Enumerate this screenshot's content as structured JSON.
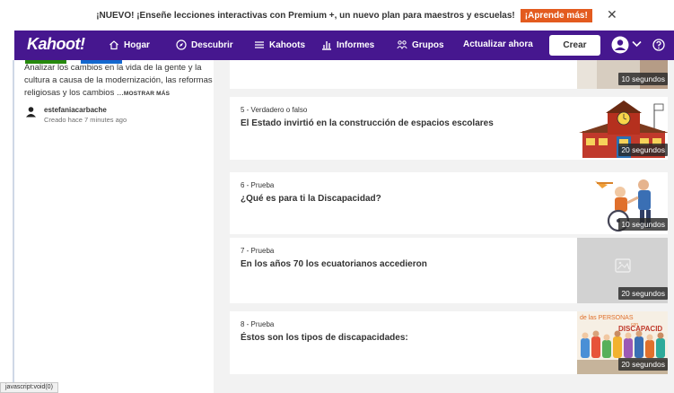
{
  "announcement": {
    "text": "¡NUEVO! ¡Enseñe lecciones interactivas con Premium +, un nuevo plan para maestros y escuelas!",
    "cta": "¡Aprende más!",
    "close_icon": "close-icon"
  },
  "nav": {
    "logo": "Kahoot!",
    "items": [
      {
        "label": "Hogar",
        "icon": "home-icon"
      },
      {
        "label": "Descubrir",
        "icon": "compass-icon"
      },
      {
        "label": "Kahoots",
        "icon": "list-icon"
      },
      {
        "label": "Informes",
        "icon": "chart-icon"
      },
      {
        "label": "Grupos",
        "icon": "group-icon"
      }
    ],
    "upgrade": "Actualizar ahora",
    "create": "Crear",
    "colors": {
      "bar": "#46178f",
      "cta": "#e35b1f"
    }
  },
  "sidebar": {
    "description": "Analizar los cambios en la vida de la gente y la cultura a causa de la modernización, las reformas religiosas y los cambios ...",
    "show_more": "MOSTRAR MÁS",
    "author": "estefaniacarbache",
    "created": "Creado hace 7 minutes ago"
  },
  "questions": [
    {
      "meta": "",
      "title": "",
      "time": "10 segundos"
    },
    {
      "meta": "5 - Verdadero o falso",
      "title": "El Estado invirtió en la construcción de espacios escolares",
      "time": "20 segundos"
    },
    {
      "meta": "6 - Prueba",
      "title": "¿Qué es para ti la Discapacidad?",
      "time": "10 segundos"
    },
    {
      "meta": "7 - Prueba",
      "title": "En los años 70 los ecuatorianos accedieron",
      "time": "20 segundos"
    },
    {
      "meta": "8 - Prueba",
      "title": "Éstos son los tipos de discapacidades:",
      "time": "20 segundos",
      "image_text_1": "de las PERSONAS",
      "image_text_2": "con",
      "image_text_3": "DISCAPACID"
    }
  ],
  "status_bar": "javascript:void(0)"
}
